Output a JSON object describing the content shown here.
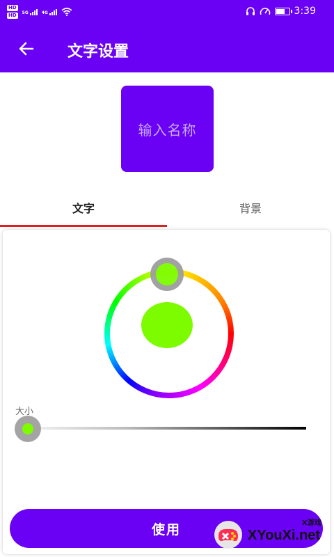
{
  "status_bar": {
    "hd_label": "HD",
    "net_1": "5G",
    "net_2": "4G",
    "time": "3:39"
  },
  "header": {
    "title": "文字设置",
    "back_icon": "arrow-left-icon",
    "background": "#6a00f4"
  },
  "preview": {
    "placeholder": "输入名称",
    "background": "#6a00f4"
  },
  "tabs": [
    {
      "label": "文字",
      "active": true
    },
    {
      "label": "背景",
      "active": false
    }
  ],
  "color_picker": {
    "selected_color": "#7dfc00"
  },
  "size": {
    "label": "大小",
    "value_fraction": 0.0
  },
  "use_button": {
    "label": "使用"
  },
  "watermark": {
    "small": "X游戏",
    "text": "XYouXi.net"
  }
}
